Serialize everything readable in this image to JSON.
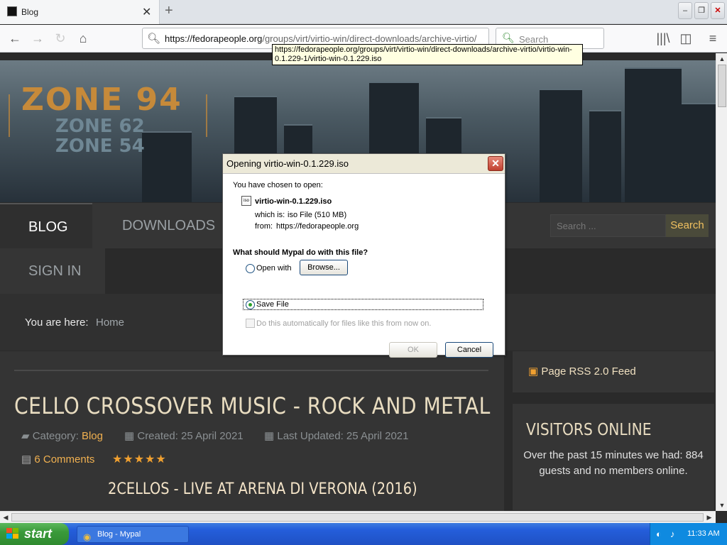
{
  "browser": {
    "tab_title": "Blog",
    "url_host": "https://fedorapeople.org",
    "url_path": "/groups/virt/virtio-win/direct-downloads/archive-virtio/",
    "search_placeholder": "Search",
    "tooltip": "https://fedorapeople.org/groups/virt/virtio-win/direct-downloads/archive-virtio/virtio-win-0.1.229-1/virtio-win-0.1.229.iso"
  },
  "site": {
    "logo_main": "ZONE 94",
    "logo_sub1": "ZONE 62",
    "logo_sub2": "ZONE 54",
    "menu": {
      "blog": "BLOG",
      "downloads": "DOWNLOADS",
      "signin": "SIGN IN"
    },
    "search_placeholder": "Search ...",
    "search_button": "Search",
    "breadcrumb_label": "You are here:",
    "breadcrumb_home": "Home"
  },
  "article": {
    "title": "CELLO CROSSOVER MUSIC - ROCK AND METAL",
    "category_label": "Category:",
    "category": "Blog",
    "created": "Created: 25 April 2021",
    "updated": "Last Updated: 25 April 2021",
    "comments": "6 Comments",
    "rating_stars": 5,
    "subtitle": "2CELLOS - LIVE AT ARENA DI VERONA (2016)"
  },
  "sidebar": {
    "rss": "Page RSS 2.0 Feed",
    "visitors_title": "VISITORS ONLINE",
    "visitors_text": "Over the past 15 minutes we had: 884 guests and no members online."
  },
  "dialog": {
    "title": "Opening virtio-win-0.1.229.iso",
    "chosen": "You have chosen to open:",
    "filename": "virtio-win-0.1.229.iso",
    "file_icon": "iso",
    "which_is_label": "which is:",
    "which_is_value": "iso File (510 MB)",
    "from_label": "from:",
    "from_value": "https://fedorapeople.org",
    "question": "What should Mypal do with this file?",
    "open_with": "Open with",
    "browse": "Browse...",
    "save_file": "Save File",
    "auto": "Do this automatically for files like this from now on.",
    "ok": "OK",
    "cancel": "Cancel"
  },
  "taskbar": {
    "start": "start",
    "task": "Blog - Mypal",
    "clock": "11:33 AM"
  }
}
